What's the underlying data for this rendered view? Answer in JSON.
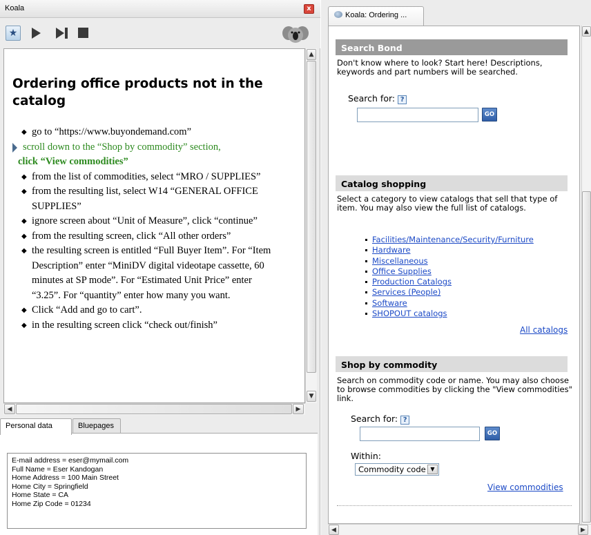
{
  "left_panel": {
    "title": "Koala",
    "close_symbol": "x",
    "toolbar": {
      "icons": [
        "star-icon",
        "play-icon",
        "step-icon",
        "stop-icon",
        "koala-logo"
      ]
    },
    "document": {
      "title": "Ordering office products not in the catalog",
      "steps": [
        {
          "text": "go to “https://www.buyondemand.com”"
        },
        {
          "text_a": "scroll down to the “Shop by commodity” section,",
          "text_b": "click “View commodities”"
        },
        {
          "text": "from the list of commodities, select “MRO / SUPPLIES”"
        },
        {
          "text": "from the resulting list, select W14 “GENERAL OFFICE SUPPLIES”"
        },
        {
          "text": "ignore screen about “Unit of Measure”, click “continue”"
        },
        {
          "text": "from the resulting screen, click “All other orders”"
        },
        {
          "text": "the resulting screen is entitled “Full Buyer Item”. For “Item Description” enter “MiniDV digital videotape cassette, 60 minutes at SP mode”. For “Estimated Unit Price” enter “3.25”. For “quantity” enter how many you want."
        },
        {
          "text": "Click “Add and go to cart”."
        },
        {
          "text": "in the resulting screen click “check out/finish”"
        }
      ]
    },
    "tabs": [
      {
        "label": "Personal data"
      },
      {
        "label": "Bluepages"
      }
    ],
    "personal_data": [
      "E-mail address = eser@mymail.com",
      "Full Name = Eser Kandogan",
      "Home Address = 100 Main Street",
      "Home City = Springfield",
      "Home State = CA",
      "Home Zip Code = 01234"
    ]
  },
  "right_panel": {
    "tab_label": "Koala: Ordering ...",
    "search_bond": {
      "heading": "Search Bond",
      "description": "Don't know where to look? Start here! Descriptions, keywords and part numbers will be searched.",
      "search_label": "Search for:",
      "help_symbol": "?",
      "go_label": "GO",
      "value": ""
    },
    "catalog_shopping": {
      "heading": "Catalog shopping",
      "description": "Select a category to view catalogs that sell that type of item. You may also view the full list of catalogs.",
      "categories": [
        "Facilities/Maintenance/Security/Furniture",
        "Hardware",
        "Miscellaneous",
        "Office Supplies",
        "Production Catalogs",
        "Services (People)",
        "Software",
        "SHOPOUT catalogs"
      ],
      "all_catalogs_label": "All catalogs"
    },
    "shop_by_commodity": {
      "heading": "Shop by commodity",
      "description": "Search on commodity code or name. You may also choose to browse commodities by clicking the \"View commodities\" link.",
      "search_label": "Search for:",
      "help_symbol": "?",
      "go_label": "GO",
      "value": "",
      "within_label": "Within:",
      "within_selected": "Commodity code",
      "view_commodities_label": "View commodities"
    }
  },
  "colors": {
    "current_step": "#2d8a1f",
    "link": "#1b49c6",
    "go_button": "#2f5ea8",
    "section_header_dark": "#9a9a9a",
    "section_header_light": "#dcdcdc",
    "close_button": "#d9463a"
  }
}
